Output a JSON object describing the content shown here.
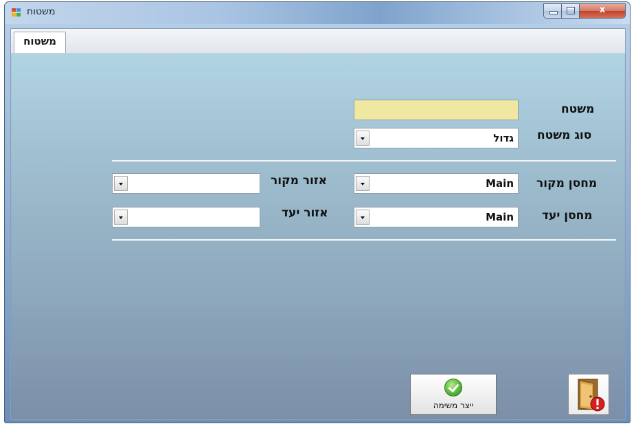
{
  "window": {
    "title": "משטוח",
    "close_glyph": "x"
  },
  "tabs": [
    {
      "label": "משטוח"
    }
  ],
  "form": {
    "pallet_label": "משטח",
    "pallet_value": "",
    "pallet_type_label": "סוג משטח",
    "pallet_type_value": "גדול",
    "source_warehouse_label": "מחסן מקור",
    "source_warehouse_value": "Main",
    "source_area_label": "אזור מקור",
    "source_area_value": "",
    "target_warehouse_label": "מחסן יעד",
    "target_warehouse_value": "Main",
    "target_area_label": "אזור יעד",
    "target_area_value": ""
  },
  "actions": {
    "create_task_label": "ייצר משימה",
    "create_task_icon": "check-icon",
    "exit_icon": "exit-door-icon"
  },
  "colors": {
    "pallet_field_bg": "#f0e8a0",
    "panel_top": "#b1d4e3",
    "panel_bottom": "#7b8fa8"
  }
}
